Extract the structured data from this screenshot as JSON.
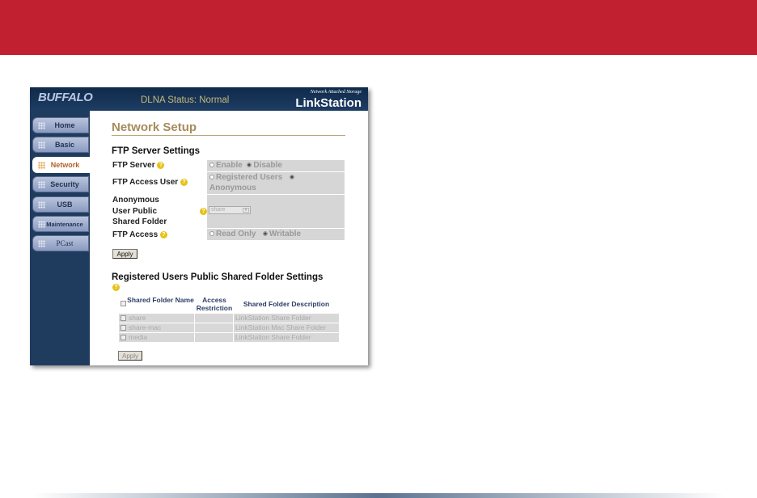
{
  "header": {
    "logo": "BUFFALO",
    "dlna_status": "DLNA Status: Normal",
    "tagline": "Network Attached Storage",
    "product": "LinkStation"
  },
  "sidebar": {
    "items": [
      {
        "label": "Home"
      },
      {
        "label": "Basic"
      },
      {
        "label": "Network",
        "active": true
      },
      {
        "label": "Security"
      },
      {
        "label": "USB"
      },
      {
        "label": "Maintenance"
      },
      {
        "label": "PCast"
      }
    ]
  },
  "main": {
    "title": "Network Setup",
    "ftp": {
      "heading": "FTP Server Settings",
      "server_label": "FTP Server",
      "server_options": [
        "Enable",
        "Disable"
      ],
      "server_selected": "Disable",
      "access_user_label": "FTP Access User",
      "access_user_options": [
        "Registered Users",
        "Anonymous"
      ],
      "access_user_selected": "Anonymous",
      "anon_folder_label": "Anonymous User Public Shared Folder",
      "anon_folder_value": "share",
      "access_label": "FTP Access",
      "access_options": [
        "Read Only",
        "Writable"
      ],
      "access_selected": "Writable",
      "apply": "Apply"
    },
    "registered": {
      "heading": "Registered Users Public Shared Folder Settings",
      "columns": [
        "Shared Folder Name",
        "Access Restriction",
        "Shared Folder Description"
      ],
      "rows": [
        {
          "name": "share",
          "access": "",
          "desc": "LinkStation Share Folder"
        },
        {
          "name": "share-mac",
          "access": "",
          "desc": "LinkStation Mac Share Folder"
        },
        {
          "name": "media",
          "access": "",
          "desc": "LinkStation Share Folder"
        }
      ],
      "apply": "Apply"
    }
  },
  "colors": {
    "banner": "#c0202f",
    "sidebar": "#1f3c5e",
    "title": "#a68b5b"
  }
}
